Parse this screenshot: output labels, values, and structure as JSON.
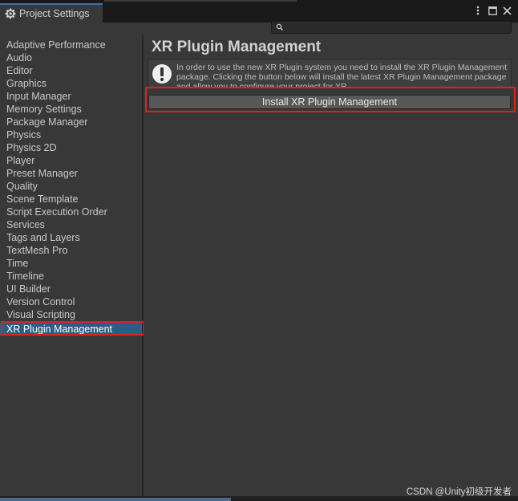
{
  "window": {
    "tab_title": "Project Settings",
    "icons": {
      "tab": "gear-icon",
      "menu": "kebab-menu-icon",
      "maximize": "maximize-icon",
      "close": "close-icon",
      "search": "search-icon"
    }
  },
  "search": {
    "value": "",
    "placeholder": ""
  },
  "sidebar": {
    "items": [
      {
        "label": "Adaptive Performance"
      },
      {
        "label": "Audio"
      },
      {
        "label": "Editor"
      },
      {
        "label": "Graphics"
      },
      {
        "label": "Input Manager"
      },
      {
        "label": "Memory Settings"
      },
      {
        "label": "Package Manager"
      },
      {
        "label": "Physics"
      },
      {
        "label": "Physics 2D"
      },
      {
        "label": "Player"
      },
      {
        "label": "Preset Manager"
      },
      {
        "label": "Quality"
      },
      {
        "label": "Scene Template"
      },
      {
        "label": "Script Execution Order"
      },
      {
        "label": "Services"
      },
      {
        "label": "Tags and Layers"
      },
      {
        "label": "TextMesh Pro"
      },
      {
        "label": "Time"
      },
      {
        "label": "Timeline"
      },
      {
        "label": "UI Builder"
      },
      {
        "label": "Version Control"
      },
      {
        "label": "Visual Scripting"
      },
      {
        "label": "XR Plugin Management"
      }
    ],
    "selected": "XR Plugin Management"
  },
  "main": {
    "title": "XR Plugin Management",
    "help_text": "In order to use the new XR Plugin system you need to install the XR Plugin Management package. Clicking the button below will install the latest XR Plugin Management package and allow you to configure your project for XR.",
    "help_icon": "warning-icon",
    "install_button": "Install XR Plugin Management"
  },
  "watermark": "CSDN @Unity初级开发者",
  "colors": {
    "highlight": "#d8231f",
    "selected": "#2c5d87",
    "accent": "#3a72b0"
  }
}
